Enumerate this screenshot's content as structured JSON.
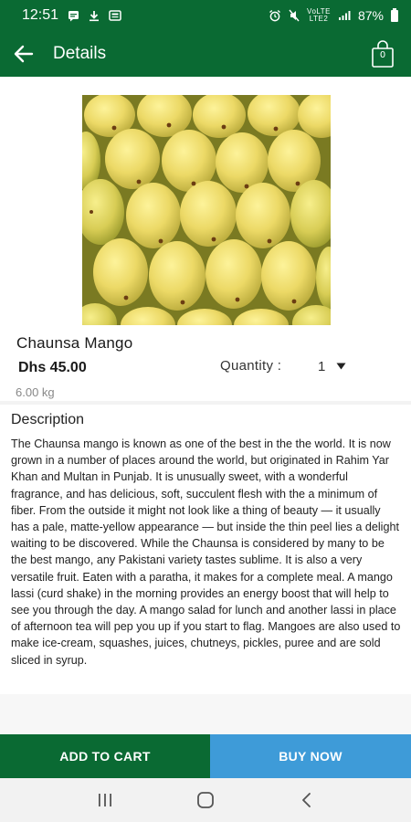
{
  "status_bar": {
    "time": "12:51",
    "battery": "87%",
    "network_top": "VoLTE",
    "network_bottom": "LTE2",
    "icons": [
      "message-icon",
      "download-icon",
      "news-icon",
      "alarm-icon",
      "mute-icon",
      "signal-icon",
      "battery-icon"
    ]
  },
  "app_bar": {
    "title": "Details",
    "cart_count": "0",
    "icons": [
      "arrow-left-icon",
      "shopping-bag-icon"
    ]
  },
  "product": {
    "name": "Chaunsa Mango",
    "price": "Dhs 45.00",
    "quantity_label": "Quantity :",
    "quantity_value": "1",
    "weight": "6.00 kg",
    "image_alt": "mango-photo"
  },
  "description": {
    "title": "Description",
    "text": "The Chaunsa mango is known as one of the best in the the world. It is now grown in a number of places around the world, but originated in Rahim Yar Khan and Multan in Punjab. It is unusually sweet, with a wonderful fragrance, and has delicious, soft, succulent flesh with the a minimum of fiber. From the outside it might not look like a thing of beauty — it usually has a pale, matte-yellow appearance — but inside the thin peel lies a delight waiting to be discovered. While the Chaunsa is considered by many to be the best mango, any Pakistani variety tastes sublime. It is also a very versatile fruit. Eaten with a paratha, it makes for a complete meal. A mango lassi (curd shake) in the morning provides an energy boost that will help to see you through the day. A mango salad for lunch and another lassi in place of afternoon tea will pep you up if you start to flag. Mangoes are also used to make ice-cream, squashes, juices, chutneys, pickles, puree and are sold sliced in syrup."
  },
  "actions": {
    "add_to_cart": "ADD TO CART",
    "buy_now": "BUY NOW"
  },
  "colors": {
    "brand_green": "#0a6a33",
    "buy_blue": "#3e9bd8"
  },
  "nav_bar": {
    "icons": [
      "recent-apps-icon",
      "home-icon",
      "back-icon"
    ]
  }
}
